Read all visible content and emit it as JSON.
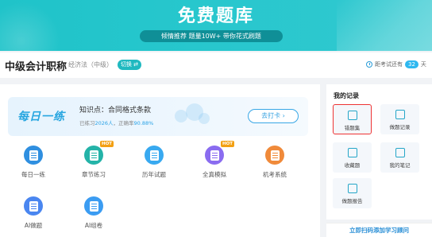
{
  "banner": {
    "title": "免费题库",
    "pill": "倾情推荐 题量10W+ 带你花式刷题"
  },
  "subject": {
    "title": "中级会计职称",
    "sub": "经济法（中级）",
    "switch_label": "切换 ⇄",
    "countdown_prefix": "距考试还有",
    "countdown_days": "32",
    "countdown_suffix": "天"
  },
  "daily": {
    "title": "每日一练",
    "point": "知识点：合同格式条款",
    "stat_prefix": "已练习",
    "stat_count": "2026人",
    "stat_mid": "，正确率",
    "stat_rate": "90.88%",
    "checkin_label": "去打卡 ›"
  },
  "features": [
    {
      "label": "每日一练",
      "color": "#2f8fe0",
      "icon": "calendar-icon"
    },
    {
      "label": "章节练习",
      "color": "#24b3a8",
      "icon": "document-icon",
      "hot": "HOT"
    },
    {
      "label": "历年试题",
      "color": "#38a9f0",
      "icon": "paper-icon"
    },
    {
      "label": "全真模拟",
      "color": "#8a6cf0",
      "icon": "exam-icon",
      "hot": "HOT"
    },
    {
      "label": "机考系统",
      "color": "#f08a3a",
      "icon": "monitor-icon"
    },
    {
      "label": "AI做题",
      "color": "#4a86f0",
      "icon": "robot-icon"
    },
    {
      "label": "AI组卷",
      "color": "#3b9cf2",
      "icon": "ai-paper-icon"
    }
  ],
  "records": {
    "title": "我的记录",
    "items": [
      {
        "label": "错题集",
        "icon": "mistakes-icon"
      },
      {
        "label": "做题记录",
        "icon": "history-icon"
      },
      {
        "label": "收藏题",
        "icon": "star-icon"
      },
      {
        "label": "我的笔记",
        "icon": "pen-icon"
      },
      {
        "label": "做题报告",
        "icon": "report-icon"
      }
    ]
  },
  "qr": {
    "label": "立即扫码添加学习顾问"
  }
}
